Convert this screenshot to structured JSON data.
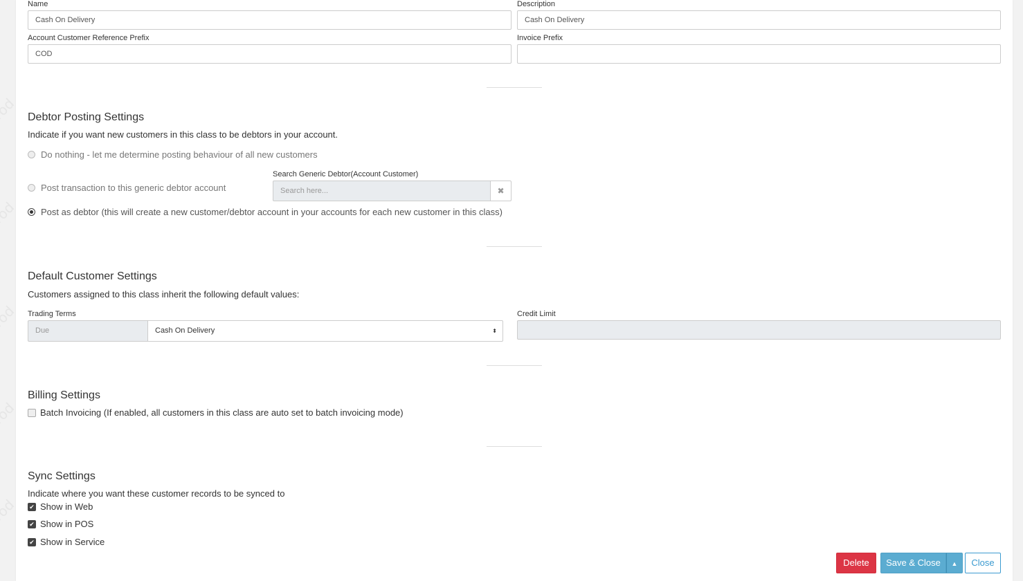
{
  "general": {
    "name_label": "Name",
    "name_value": "Cash On Delivery",
    "description_label": "Description",
    "description_value": "Cash On Delivery",
    "prefix_label": "Account Customer Reference Prefix",
    "prefix_value": "COD",
    "invoice_prefix_label": "Invoice Prefix",
    "invoice_prefix_value": ""
  },
  "debtor": {
    "title": "Debtor Posting Settings",
    "description": "Indicate if you want new customers in this class to be debtors in your account.",
    "option_nothing": "Do nothing - let me determine posting behaviour of all new customers",
    "option_generic": "Post transaction to this generic debtor account",
    "search_label": "Search Generic Debtor(Account Customer)",
    "search_placeholder": "Search here...",
    "option_post_debtor": "Post as debtor (this will create a new customer/debtor account in your accounts for each new customer in this class)",
    "selected": "post_debtor"
  },
  "defaults": {
    "title": "Default Customer Settings",
    "description": "Customers assigned to this class inherit the following default values:",
    "trading_terms_label": "Trading Terms",
    "trading_terms_addon": "Due",
    "trading_terms_value": "Cash On Delivery",
    "credit_limit_label": "Credit Limit",
    "credit_limit_value": ""
  },
  "billing": {
    "title": "Billing Settings",
    "batch_invoicing_label": "Batch Invoicing (If enabled, all customers in this class are auto set to batch invoicing mode)",
    "batch_invoicing_checked": false
  },
  "sync": {
    "title": "Sync Settings",
    "description": "Indicate where you want these customer records to be synced to",
    "show_web": "Show in Web",
    "show_pos": "Show in POS",
    "show_service": "Show in Service"
  },
  "actions": {
    "delete": "Delete",
    "save_close": "Save & Close",
    "close": "Close"
  },
  "colors": {
    "danger": "#dc3545",
    "info": "#5bacd1",
    "outline": "#3a9ad0"
  }
}
